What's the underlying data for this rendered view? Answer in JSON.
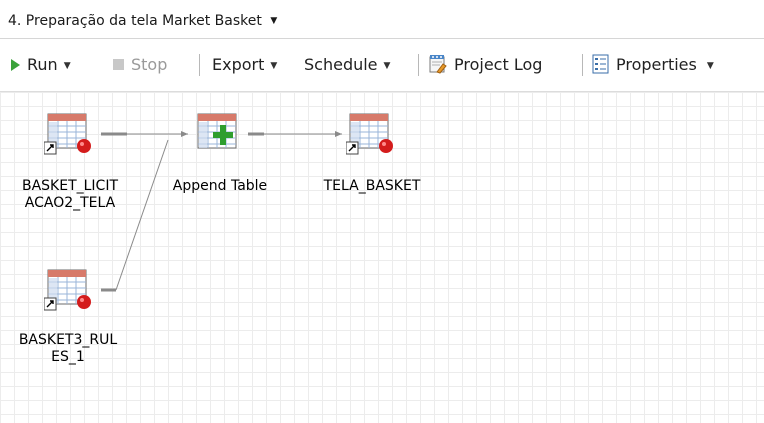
{
  "window": {
    "title": "4. Preparação da tela Market Basket"
  },
  "toolbar": {
    "run_label": "Run",
    "stop_label": "Stop",
    "export_label": "Export",
    "schedule_label": "Schedule",
    "project_log_label": "Project Log",
    "properties_label": "Properties"
  },
  "nodes": {
    "basket_licitacao2": {
      "label_line1": "BASKET_LICIT",
      "label_line2": "ACAO2_TELA",
      "icon": "table-shortcut-icon"
    },
    "append_table": {
      "label": "Append Table",
      "icon": "append-table-icon"
    },
    "tela_basket": {
      "label": "TELA_BASKET",
      "icon": "table-shortcut-icon"
    },
    "basket3_rules": {
      "label_line1": "BASKET3_RUL",
      "label_line2": "ES_1",
      "icon": "table-shortcut-icon"
    }
  },
  "colors": {
    "grid": "#ececec",
    "run_green": "#3aa23a",
    "stop_gray": "#c8c8c8",
    "node_red": "#d41c1c",
    "connector": "#8a8a8a"
  }
}
